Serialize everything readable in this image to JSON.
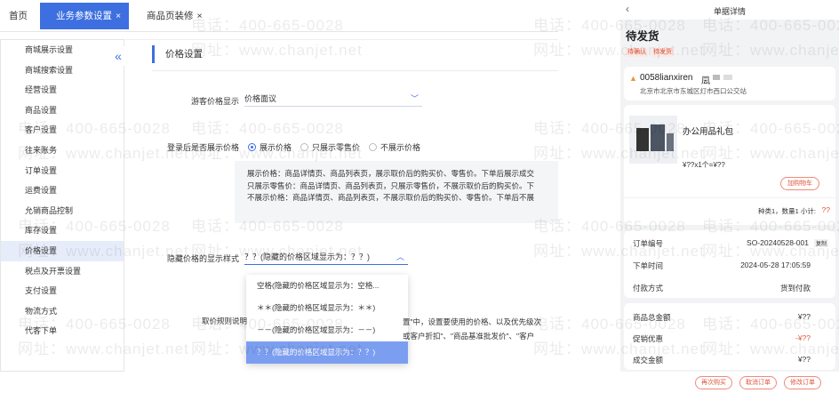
{
  "tabs": {
    "home": "首页",
    "active": "业务参数设置",
    "decor": "商品页装修",
    "close": "×"
  },
  "sidebar": {
    "collapse": "«",
    "items": [
      "商城展示设置",
      "商城搜索设置",
      "经营设置",
      "商品设置",
      "客户设置",
      "往来账务",
      "订单设置",
      "运费设置",
      "允销商品控制",
      "库存设置",
      "价格设置",
      "税点及开票设置",
      "支付设置",
      "物流方式",
      "代客下单"
    ],
    "active_index": 10
  },
  "main": {
    "section_title": "价格设置",
    "guest_label": "游客价格显示",
    "guest_value": "价格面议",
    "login_label": "登录后是否展示价格",
    "radios": [
      "展示价格",
      "只展示零售价",
      "不展示价格"
    ],
    "notes": [
      "展示价格：商品详情页、商品列表页，展示取价后的购买价、零售价。下单后展示成交",
      "只展示零售价：商品详情页、商品列表页，只展示零售价，不展示取价后的购买价。下",
      "不展示价格：商品详情页、商品列表页，不展示取价后的购买价、零售价。下单后不展"
    ],
    "hidden_label": "隐藏价格的显示样式",
    "hidden_value": "？？(隐藏的价格区域显示为：？？)",
    "options": [
      "空格(隐藏的价格区域显示为：空格...",
      "＊＊(隐藏的价格区域显示为：＊＊)",
      "－－(隐藏的价格区域显示为：－－)",
      "？？(隐藏的价格区域显示为：？？)"
    ],
    "rule_label": "取价规则说明",
    "trail1": "置\"中，设置要使用的价格、以及优先级次",
    "trail2": "或客户折扣\"、\"商品基准批发价\"、\"客户"
  },
  "mobile": {
    "back": "‹",
    "title": "单据详情",
    "status": "待发货",
    "badges": [
      "待确认",
      "待发货"
    ],
    "customer": "0058lianxiren",
    "customer_tail": "凨",
    "address": "北京市北京市东城区灯市西口公交站",
    "product": "办公用品礼包",
    "price": "¥??x1个=¥??",
    "add_cart": "加购物车",
    "summary_prefix": "种类1，数量1  小计:",
    "summary_value": "??",
    "order_no_label": "订单编号",
    "order_no": "SO-20240528-001",
    "copy": "复制",
    "time_label": "下单时间",
    "time": "2024-05-28 17:05:59",
    "pay_label": "付款方式",
    "pay": "货到付款",
    "total_label": "商品总金额",
    "total": "¥??",
    "promo_label": "促销优惠",
    "promo": "-¥??",
    "deal_label": "成交金额",
    "deal": "¥??",
    "actions": [
      "再次购买",
      "取消订单",
      "修改订单"
    ]
  },
  "watermark": {
    "phone": "电话：400-665-0028",
    "site": "网址：www.chanjet.net"
  },
  "colors": {
    "accent": "#3d6fe0",
    "danger": "#e0543b"
  }
}
